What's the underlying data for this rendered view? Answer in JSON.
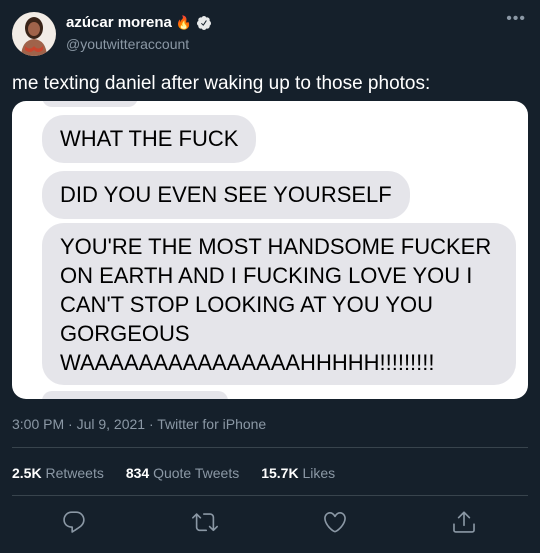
{
  "author": {
    "display_name": "azúcar morena",
    "emoji": "🔥",
    "handle": "@youtwitteraccount",
    "verified": true
  },
  "tweet": {
    "text": "me texting daniel after waking up to those photos:",
    "timestamp": "3:00 PM · Jul 9, 2021",
    "client": "Twitter for iPhone"
  },
  "media_messages": [
    "WHAT THE FUCK",
    "DID YOU EVEN SEE YOURSELF",
    "YOU'RE THE MOST HANDSOME FUCKER ON EARTH AND I FUCKING LOVE YOU I CAN'T STOP LOOKING AT YOU YOU GORGEOUS WAAAAAAAAAAAAAAAHHHHH!!!!!!!!!"
  ],
  "stats": {
    "retweets_count": "2.5K",
    "retweets_label": "Retweets",
    "quotes_count": "834",
    "quotes_label": "Quote Tweets",
    "likes_count": "15.7K",
    "likes_label": "Likes"
  },
  "icons": [
    "more-icon",
    "verified-icon",
    "reply-icon",
    "retweet-icon",
    "like-icon",
    "share-icon"
  ],
  "colors": {
    "background": "#15202b",
    "text": "#ffffff",
    "secondary": "#8b98a5",
    "divider": "#38444d",
    "verified": "#1d9bf0",
    "bubble": "#e5e5ea"
  }
}
